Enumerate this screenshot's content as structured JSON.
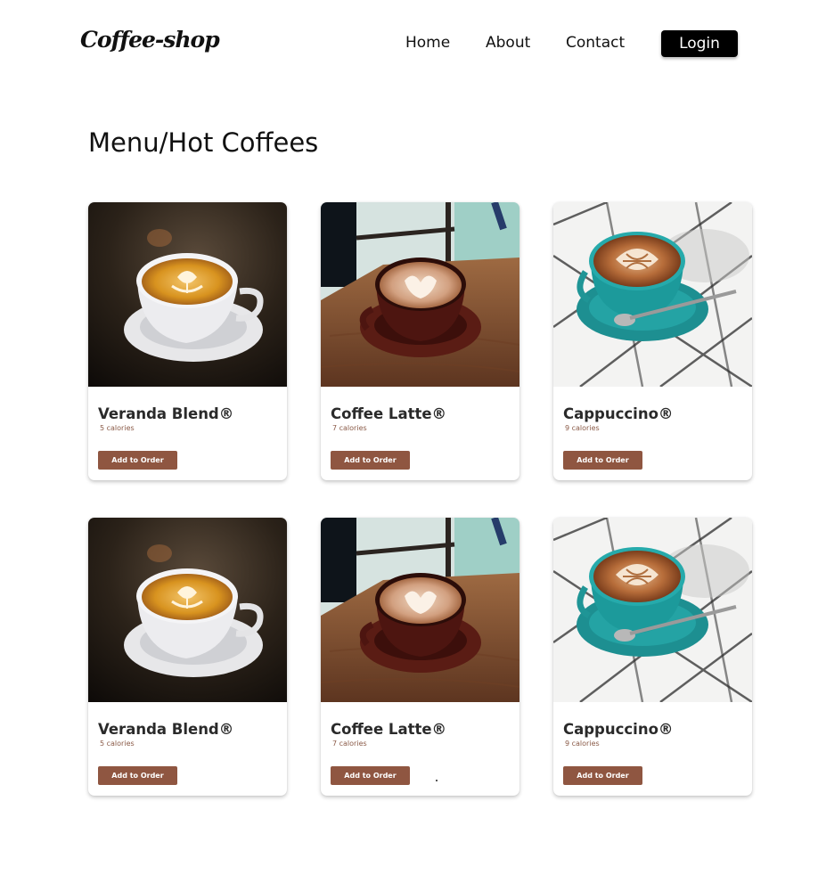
{
  "header": {
    "logo": "Coffee-shop",
    "nav": [
      "Home",
      "About",
      "Contact"
    ],
    "login_label": "Login"
  },
  "page_title": "Menu/Hot Coffees",
  "products": [
    {
      "name": "Veranda Blend®",
      "calories": "5 calories",
      "button": "Add to Order",
      "image": "white-cup-latte-dark-table"
    },
    {
      "name": "Coffee Latte®",
      "calories": "7 calories",
      "button": "Add to Order",
      "image": "brown-cup-latte-wooden-table"
    },
    {
      "name": "Cappuccino®",
      "calories": "9 calories",
      "button": "Add to Order",
      "image": "teal-cup-cappuccino-tiled-table"
    },
    {
      "name": "Veranda Blend®",
      "calories": "5 calories",
      "button": "Add to Order",
      "image": "white-cup-latte-dark-table"
    },
    {
      "name": "Coffee Latte®",
      "calories": "7 calories",
      "button": "Add to Order",
      "image": "brown-cup-latte-wooden-table"
    },
    {
      "name": "Cappuccino®",
      "calories": "9 calories",
      "button": "Add to Order",
      "image": "teal-cup-cappuccino-tiled-table"
    }
  ],
  "colors": {
    "button_brown": "#8f5641",
    "login_black": "#000000",
    "text_dark": "#2a2a2a"
  }
}
